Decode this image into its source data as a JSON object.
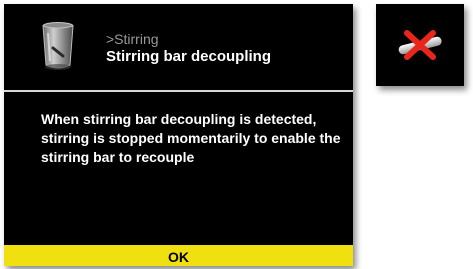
{
  "screen": {
    "breadcrumb": ">Stirring",
    "title": "Stirring bar decoupling",
    "message": "When stirring bar decoupling is detected, stirring is stopped momentarily to enable the stirring bar to recouple",
    "ok_label": "OK",
    "header_icon": "beaker-icon"
  },
  "status_panel": {
    "icon": "stir-bar-decoupled-icon"
  },
  "colors": {
    "background": "#000000",
    "ok_button": "#f0e010",
    "breadcrumb": "#9a9a9a",
    "error_cross": "#e8261c"
  }
}
